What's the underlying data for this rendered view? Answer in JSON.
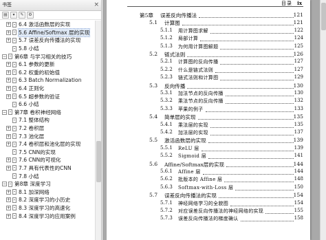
{
  "sidebar": {
    "title": "书签",
    "close": "×",
    "toolbar": [
      "▤",
      "▾",
      "✎",
      "⚙"
    ],
    "items": [
      {
        "level": 2,
        "label": "6.4 激活函数层的实现",
        "toggle": "+"
      },
      {
        "level": 2,
        "label": "5.6 Affine/Softmax 层的实现",
        "toggle": "+",
        "active": true
      },
      {
        "level": 2,
        "label": "5.7 误差反向传播法的实现",
        "toggle": "+"
      },
      {
        "level": 2,
        "label": "5.8 小结",
        "toggle": ""
      },
      {
        "level": 1,
        "label": "第6章 与学习相关的技巧",
        "toggle": "−"
      },
      {
        "level": 2,
        "label": "6.1 参数的更新",
        "toggle": "+"
      },
      {
        "level": 2,
        "label": "6.2 权重的初始值",
        "toggle": "+"
      },
      {
        "level": 2,
        "label": "6.3 Batch Normalization",
        "toggle": "+"
      },
      {
        "level": 2,
        "label": "6.4 正则化",
        "toggle": "+"
      },
      {
        "level": 2,
        "label": "6.5 超参数的验证",
        "toggle": "+"
      },
      {
        "level": 2,
        "label": "6.6 小结",
        "toggle": ""
      },
      {
        "level": 1,
        "label": "第7章 卷积神经网络",
        "toggle": "−"
      },
      {
        "level": 2,
        "label": "7.1 整体结构",
        "toggle": ""
      },
      {
        "level": 2,
        "label": "7.2 卷积层",
        "toggle": "+"
      },
      {
        "level": 2,
        "label": "7.3 池化层",
        "toggle": "+"
      },
      {
        "level": 2,
        "label": "7.4 卷积层和池化层的实现",
        "toggle": "+"
      },
      {
        "level": 2,
        "label": "7.5 CNN的实现",
        "toggle": ""
      },
      {
        "level": 2,
        "label": "7.6 CNN的可视化",
        "toggle": "+"
      },
      {
        "level": 2,
        "label": "7.7 具有代表性的CNN",
        "toggle": "+"
      },
      {
        "level": 2,
        "label": "7.8 小结",
        "toggle": ""
      },
      {
        "level": 1,
        "label": "第8章 深度学习",
        "toggle": "−"
      },
      {
        "level": 2,
        "label": "8.1 加深网络",
        "toggle": "+"
      },
      {
        "level": 2,
        "label": "8.2 深度学习的小历史",
        "toggle": "+"
      },
      {
        "level": 2,
        "label": "8.3 深度学习的高速化",
        "toggle": "+"
      },
      {
        "level": 2,
        "label": "8.4 深度学习的应用案例",
        "toggle": "+"
      }
    ]
  },
  "page": {
    "running_head": {
      "title": "目录",
      "page": "ix"
    },
    "toc": [
      {
        "kind": "chapter",
        "num": "第5章",
        "title": "误差反向传播法",
        "page": "121"
      },
      {
        "kind": "section",
        "num": "5.1",
        "title": "计算图",
        "page": "121"
      },
      {
        "kind": "sub",
        "num": "5.1.1",
        "title": "用计算图求解",
        "page": "122"
      },
      {
        "kind": "sub",
        "num": "5.1.2",
        "title": "局部计算",
        "page": "124"
      },
      {
        "kind": "sub",
        "num": "5.1.3",
        "title": "为何用计算图解题",
        "page": "125"
      },
      {
        "kind": "section",
        "num": "5.2",
        "title": "链式法则",
        "page": "126"
      },
      {
        "kind": "sub",
        "num": "5.2.1",
        "title": "计算图的反向传播",
        "page": "127"
      },
      {
        "kind": "sub",
        "num": "5.2.2",
        "title": "什么是链式法则",
        "page": "127"
      },
      {
        "kind": "sub",
        "num": "5.2.3",
        "title": "链式法则和计算图",
        "page": "129"
      },
      {
        "kind": "section",
        "num": "5.3",
        "title": "反向传播",
        "page": "130"
      },
      {
        "kind": "sub",
        "num": "5.3.1",
        "title": "加法节点的反向传播",
        "page": "130"
      },
      {
        "kind": "sub",
        "num": "5.3.2",
        "title": "乘法节点的反向传播",
        "page": "132"
      },
      {
        "kind": "sub",
        "num": "5.3.3",
        "title": "苹果的例子",
        "page": "133"
      },
      {
        "kind": "section",
        "num": "5.4",
        "title": "简单层的实现",
        "page": "135"
      },
      {
        "kind": "sub",
        "num": "5.4.1",
        "title": "乘法层的实现",
        "page": "135"
      },
      {
        "kind": "sub",
        "num": "5.4.2",
        "title": "加法层的实现",
        "page": "137"
      },
      {
        "kind": "section",
        "num": "5.5",
        "title": "激活函数层的实现",
        "page": "139"
      },
      {
        "kind": "sub",
        "num": "5.5.1",
        "title": "ReLU 层",
        "page": "139"
      },
      {
        "kind": "sub",
        "num": "5.5.2",
        "title": "Sigmoid 层",
        "page": "141"
      },
      {
        "kind": "section",
        "num": "5.6",
        "title": "Affine/Softmax层的实现",
        "page": "144"
      },
      {
        "kind": "sub",
        "num": "5.6.1",
        "title": "Affine 层",
        "page": "144"
      },
      {
        "kind": "sub",
        "num": "5.6.2",
        "title": "批版本的 Affine 层",
        "page": "148"
      },
      {
        "kind": "sub",
        "num": "5.6.3",
        "title": "Softmax-with-Loss 层",
        "page": "150"
      },
      {
        "kind": "section",
        "num": "5.7",
        "title": "误差反向传播法的实现",
        "page": "154"
      },
      {
        "kind": "sub",
        "num": "5.7.1",
        "title": "神经网络学习的全貌图",
        "page": "154"
      },
      {
        "kind": "sub",
        "num": "5.7.2",
        "title": "对应误差反向传播法的神经网络的实现",
        "page": "155"
      },
      {
        "kind": "sub",
        "num": "5.7.3",
        "title": "误差反向传播法的梯度确认",
        "page": "158"
      }
    ]
  },
  "colors": {
    "panel_border": "#b9b9b9",
    "viewer_bg": "#a9a9a9",
    "active_bg": "#dfe9f6"
  }
}
